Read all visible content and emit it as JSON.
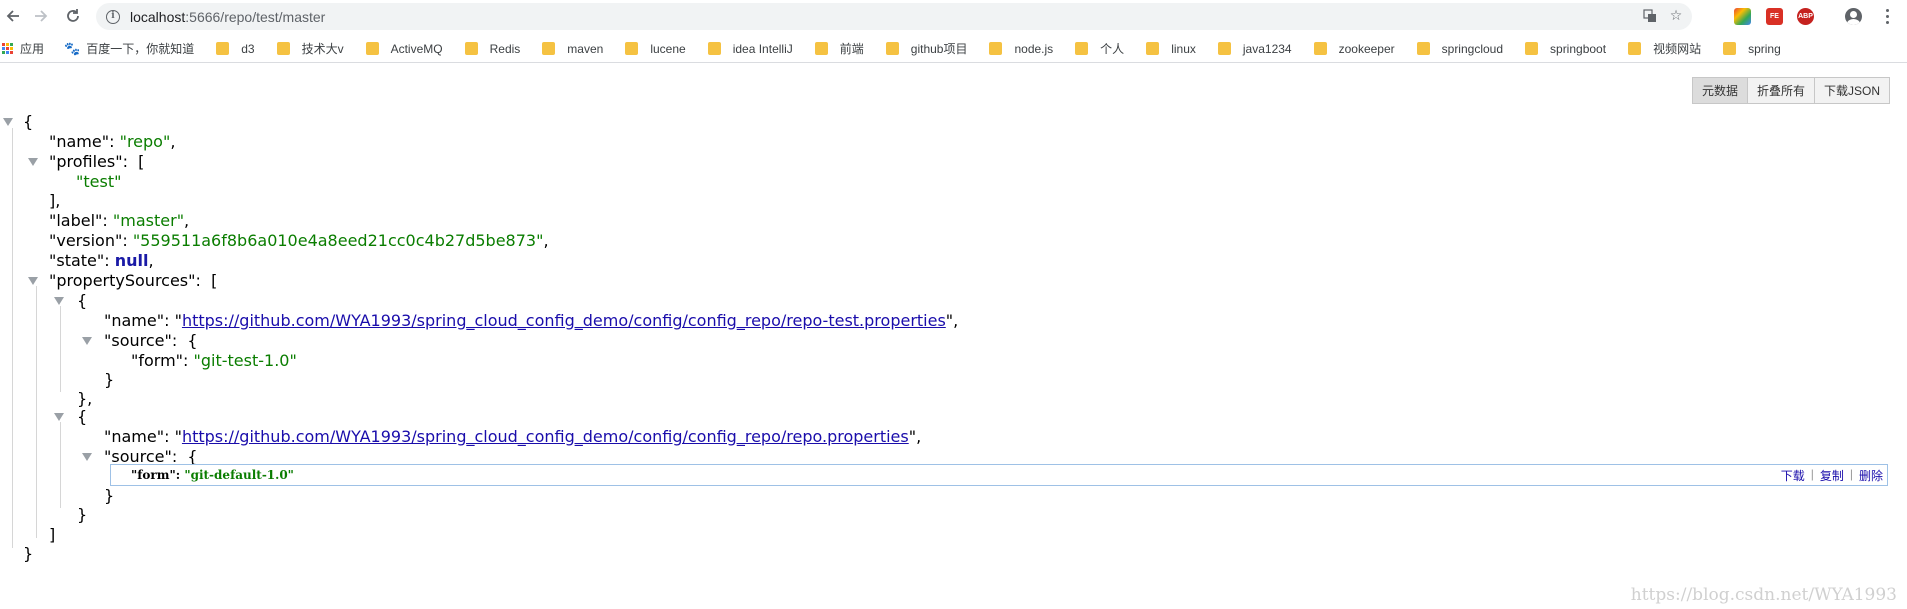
{
  "browser": {
    "url_host": "localhost",
    "url_rest": ":5666/repo/test/master"
  },
  "bookmarks": [
    {
      "label": "应用",
      "type": "apps"
    },
    {
      "label": "百度一下，你就知道",
      "type": "paw"
    },
    {
      "label": "d3",
      "type": "folder"
    },
    {
      "label": "技术大v",
      "type": "folder"
    },
    {
      "label": "ActiveMQ",
      "type": "folder"
    },
    {
      "label": "Redis",
      "type": "folder"
    },
    {
      "label": "maven",
      "type": "folder"
    },
    {
      "label": "lucene",
      "type": "folder"
    },
    {
      "label": "idea IntelliJ",
      "type": "folder"
    },
    {
      "label": "前端",
      "type": "folder"
    },
    {
      "label": "github项目",
      "type": "folder"
    },
    {
      "label": "node.js",
      "type": "folder"
    },
    {
      "label": "个人",
      "type": "folder"
    },
    {
      "label": "linux",
      "type": "folder"
    },
    {
      "label": "java1234",
      "type": "folder"
    },
    {
      "label": "zookeeper",
      "type": "folder"
    },
    {
      "label": "springcloud",
      "type": "folder"
    },
    {
      "label": "springboot",
      "type": "folder"
    },
    {
      "label": "视频网站",
      "type": "folder"
    },
    {
      "label": "spring",
      "type": "folder"
    }
  ],
  "viewer": {
    "btn_raw": "元数据",
    "btn_collapse": "折叠所有",
    "btn_download": "下载JSON"
  },
  "json": {
    "name_key": "\"name\":",
    "name_val": "\"repo\"",
    "profiles_key": "\"profiles\":",
    "profiles_0": "\"test\"",
    "label_key": "\"label\":",
    "label_val": "\"master\"",
    "version_key": "\"version\":",
    "version_val": "\"559511a6f8b6a010e4a8eed21cc0c4b27d5be873\"",
    "state_key": "\"state\":",
    "state_val": "null",
    "ps_key": "\"propertySources\":",
    "ps0_name_key": "\"name\":",
    "ps0_name_val": "https://github.com/WYA1993/spring_cloud_config_demo/config/config_repo/repo-test.properties",
    "ps0_source_key": "\"source\":",
    "ps0_form_key": "\"form\":",
    "ps0_form_val": "\"git-test-1.0\"",
    "ps1_name_key": "\"name\":",
    "ps1_name_val": "https://github.com/WYA1993/spring_cloud_config_demo/config/config_repo/repo.properties",
    "ps1_source_key": "\"source\":",
    "ps1_form_key": "\"form\":",
    "ps1_form_val": "\"git-default-1.0\""
  },
  "row_actions": {
    "download": "下载",
    "copy": "复制",
    "delete": "删除"
  },
  "watermark": "https://blog.csdn.net/WYA1993",
  "colors": {
    "string": "#0a7d00",
    "null": "#1a1aa6",
    "link": "#1a0dab"
  }
}
